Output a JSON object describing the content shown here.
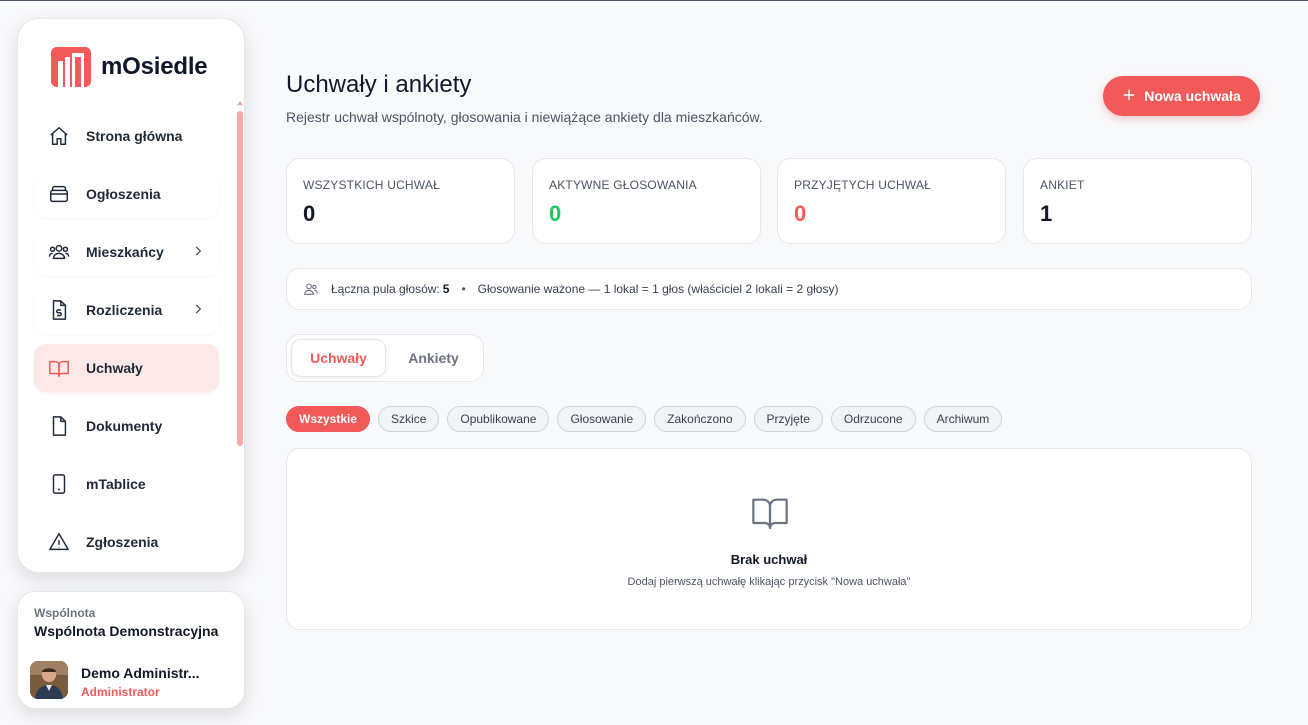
{
  "app": {
    "name": "mOsiedle",
    "brand_color": "#f25a5a"
  },
  "sidebar": {
    "items": [
      {
        "label": "Strona główna",
        "icon": "home-icon"
      },
      {
        "label": "Ogłoszenia",
        "icon": "inbox-icon"
      },
      {
        "label": "Mieszkańcy",
        "icon": "users-icon",
        "has_submenu": true
      },
      {
        "label": "Rozliczenia",
        "icon": "invoice-icon",
        "has_submenu": true
      },
      {
        "label": "Uchwały",
        "icon": "book-icon",
        "active": true
      },
      {
        "label": "Dokumenty",
        "icon": "document-icon"
      },
      {
        "label": "mTablice",
        "icon": "tablet-icon"
      },
      {
        "label": "Zgłoszenia",
        "icon": "warning-icon"
      }
    ]
  },
  "community": {
    "label": "Wspólnota",
    "name": "Wspólnota Demonstracyjna",
    "user_name": "Demo Administr...",
    "user_role": "Administrator"
  },
  "header": {
    "title": "Uchwały i ankiety",
    "subtitle": "Rejestr uchwał wspólnoty, głosowania i niewiążące ankiety dla mieszkańców.",
    "new_button": "Nowa uchwała"
  },
  "stats": [
    {
      "label": "WSZYSTKICH UCHWAŁ",
      "value": "0",
      "color": "#111827"
    },
    {
      "label": "AKTYWNE GŁOSOWANIA",
      "value": "0",
      "color": "#22c55e"
    },
    {
      "label": "PRZYJĘTYCH UCHWAŁ",
      "value": "0",
      "color": "#f25a5a"
    },
    {
      "label": "ANKIET",
      "value": "1",
      "color": "#111827"
    }
  ],
  "pool": {
    "label": "Łączna pula głosów:",
    "value": "5",
    "separator": "•",
    "note": "Głosowanie ważone — 1 lokal = 1 głos (właściciel 2 lokali = 2 głosy)"
  },
  "tabs": [
    {
      "label": "Uchwały",
      "active": true
    },
    {
      "label": "Ankiety",
      "active": false
    }
  ],
  "filters": [
    "Wszystkie",
    "Szkice",
    "Opublikowane",
    "Głosowanie",
    "Zakończono",
    "Przyjęte",
    "Odrzucone",
    "Archiwum"
  ],
  "empty_state": {
    "icon": "book-icon",
    "title": "Brak uchwał",
    "description": "Dodaj pierwszą uchwałę klikając przycisk \"Nowa uchwała\""
  }
}
